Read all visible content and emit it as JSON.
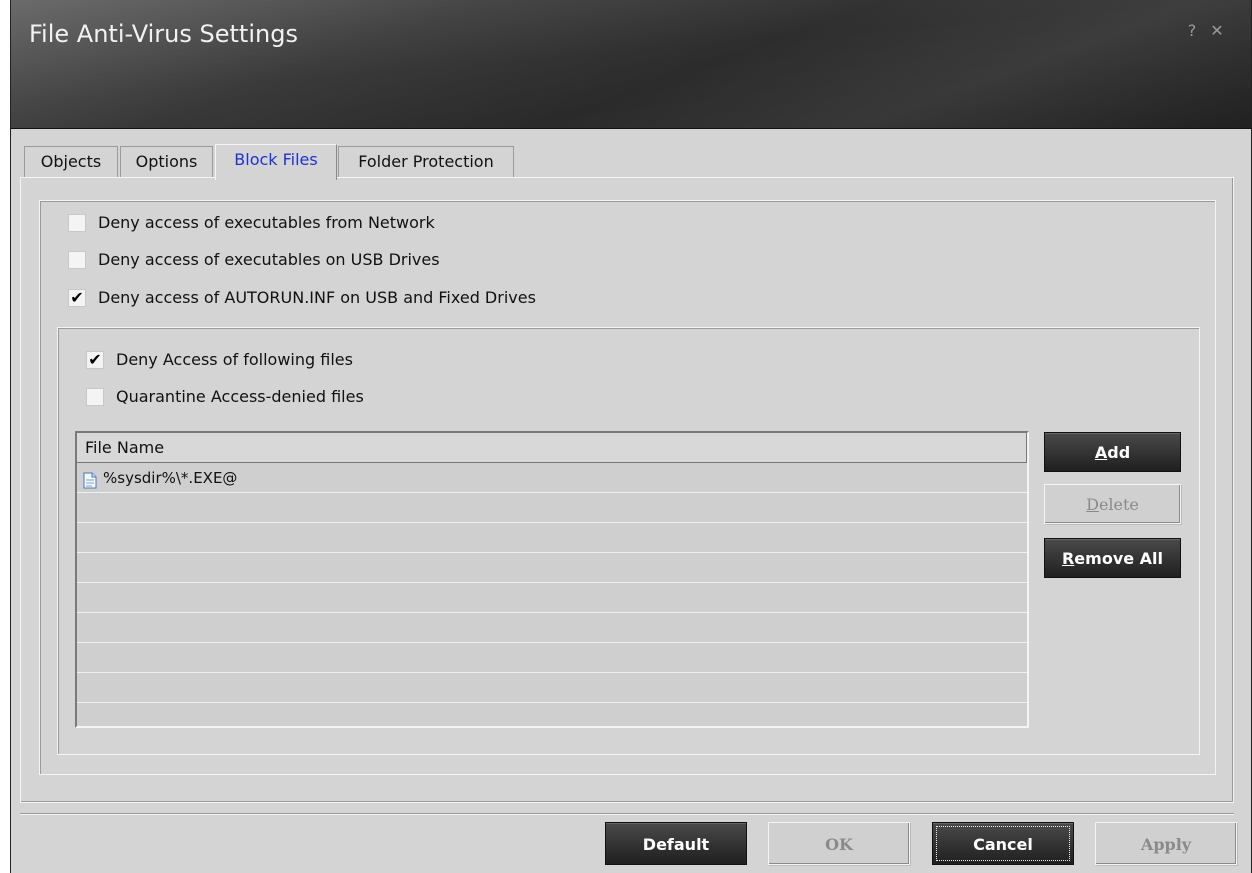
{
  "window": {
    "title": "File Anti-Virus Settings",
    "help_glyph": "?",
    "close_glyph": "✕"
  },
  "tabs": [
    {
      "label": "Objects",
      "active": false
    },
    {
      "label": "Options",
      "active": false
    },
    {
      "label": "Block Files",
      "active": true
    },
    {
      "label": "Folder Protection",
      "active": false
    }
  ],
  "options": {
    "deny_network": {
      "label": "Deny access of executables from Network",
      "checked": false
    },
    "deny_usb": {
      "label": "Deny access of executables on USB Drives",
      "checked": false
    },
    "deny_autorun": {
      "label": "Deny access of AUTORUN.INF on USB and Fixed Drives",
      "checked": true
    },
    "deny_following": {
      "label": "Deny Access of following files",
      "checked": true
    },
    "quarantine": {
      "label": "Quarantine Access-denied files",
      "checked": false
    }
  },
  "file_list": {
    "header": "File Name",
    "rows": [
      "%sysdir%\\*.EXE@",
      "",
      "",
      "",
      "",
      "",
      "",
      "",
      ""
    ]
  },
  "side_buttons": {
    "add": {
      "label": "Add",
      "mnemonic": "A",
      "rest": "dd"
    },
    "delete": {
      "label": "Delete",
      "mnemonic": "D",
      "rest": "elete"
    },
    "remove_all": {
      "label": "Remove All",
      "mnemonic": "R",
      "rest": "emove All"
    }
  },
  "footer_buttons": {
    "default": "Default",
    "ok": "OK",
    "cancel": "Cancel",
    "apply": "Apply"
  },
  "colors": {
    "active_tab_text": "#1a33d8",
    "dialog_background": "#d4d4d4",
    "dark_button": "#2b2b2b"
  },
  "check_glyph": "✔"
}
